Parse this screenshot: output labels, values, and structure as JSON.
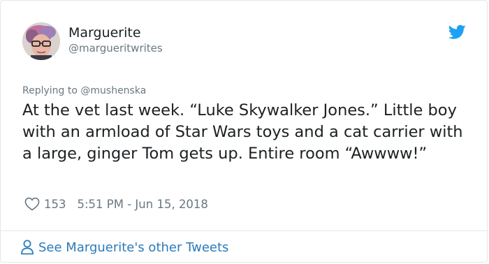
{
  "tweet": {
    "author": {
      "name": "Marguerite",
      "handle": "@margueritwrites",
      "avatar_icon": "profile-photo"
    },
    "brand_icon": "twitter-bird-icon",
    "brand_color": "#1da1f2",
    "replying_to_prefix": "Replying to",
    "replying_to_handle": "@mushenska",
    "text": "At the vet last week. “Luke Skywalker Jones.” Little boy with an armload of Star Wars toys and a cat carrier with a large, ginger Tom gets up. Entire room “Awwww!”",
    "likes": "153",
    "timestamp": "5:51 PM - Jun 15, 2018"
  },
  "footer": {
    "link_label": "See Marguerite's other Tweets",
    "link_icon": "person-icon",
    "link_color": "#2b7bb9"
  }
}
